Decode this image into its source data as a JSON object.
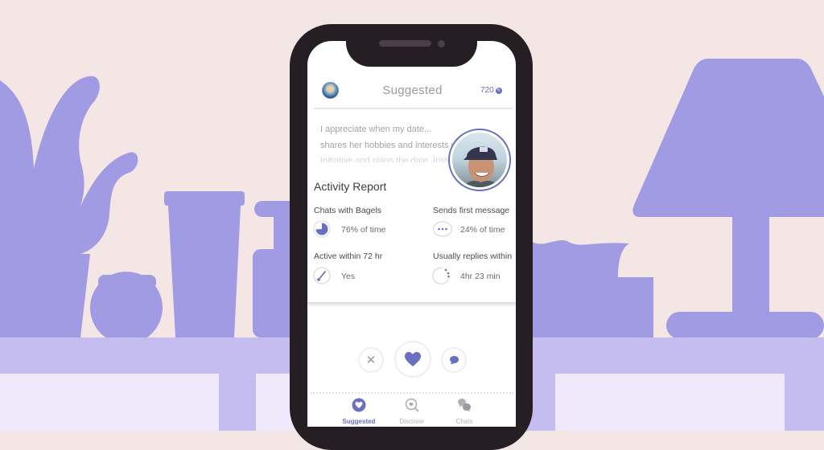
{
  "colors": {
    "background": "#f3e6e4",
    "illustration": "#a09be2",
    "shelf": "#c5bdf0",
    "accent": "#6a6fc2",
    "phone_frame": "#251e22"
  },
  "app": {
    "header": {
      "logo_icon": "bagel-logo-icon",
      "title": "Suggested",
      "bean_count": "720",
      "bean_icon": "bean-icon"
    },
    "profile": {
      "prompt_lines": [
        "I appreciate when my date...",
        "shares her hobbies and interests w",
        "Initiative and plans the date. Instead"
      ],
      "avatar_icon": "profile-photo"
    },
    "activity_report": {
      "title": "Activity Report",
      "stats": [
        {
          "label": "Chats with Bagels",
          "value": "76% of time",
          "icon": "pie-chart-icon",
          "percent": 76
        },
        {
          "label": "Sends first message",
          "value": "24% of time",
          "icon": "chat-bubble-icon",
          "percent": 24
        },
        {
          "label": "Active within 72 hr",
          "value": "Yes",
          "icon": "gauge-icon"
        },
        {
          "label": "Usually replies within",
          "value": "4hr 23 min",
          "icon": "clock-dots-icon"
        }
      ]
    },
    "actions": {
      "pass_icon": "close-icon",
      "like_icon": "heart-icon",
      "message_icon": "chat-icon"
    },
    "bottom_nav": [
      {
        "label": "Suggested",
        "icon": "heart-circle-icon",
        "active": true
      },
      {
        "label": "Discover",
        "icon": "search-heart-icon",
        "active": false
      },
      {
        "label": "Chats",
        "icon": "chats-icon",
        "active": false
      }
    ]
  }
}
